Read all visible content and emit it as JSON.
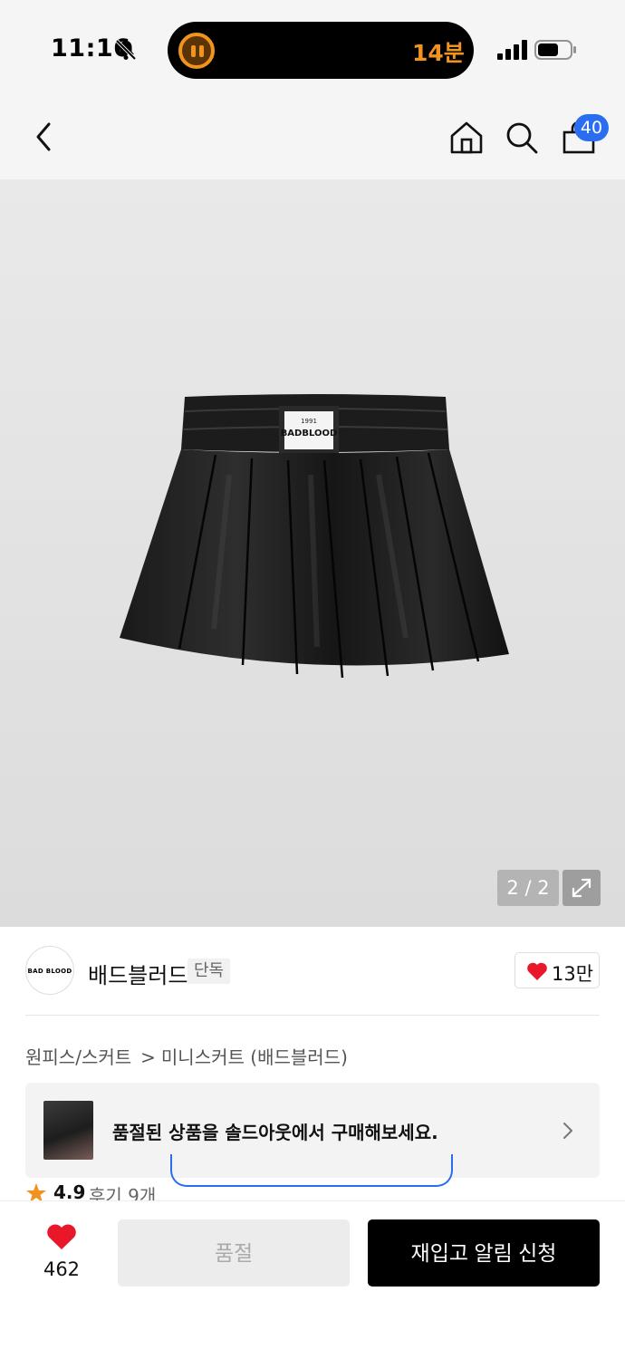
{
  "status_bar": {
    "time": "11:16",
    "timer": "14분",
    "bell_icon": "bell-slash-icon",
    "signal_icon": "cellular-signal-icon",
    "battery_icon": "battery-icon"
  },
  "header": {
    "back_icon": "chevron-left-icon",
    "home_icon": "home-icon",
    "search_icon": "search-icon",
    "cart_icon": "shopping-bag-icon",
    "cart_count": "40",
    "badge_color": "#2b6df0"
  },
  "gallery": {
    "counter": "2 / 2",
    "expand_icon": "expand-icon",
    "label_text": "BADBLOOD",
    "label_year": "1991"
  },
  "brand": {
    "logo_text": "BAD BLOOD",
    "name": "배드블러드",
    "tag": "단독",
    "likes": "13만"
  },
  "breadcrumb": {
    "items": [
      "원피스/스커트",
      "미니스커트 (배드블러드)"
    ],
    "separator": ">"
  },
  "soldout_card": {
    "text": "품절된 상품을 솔드아웃에서 구매해보세요.",
    "chevron_icon": "chevron-right-icon"
  },
  "rating": {
    "score": "4.9",
    "review_label": "후기 9개",
    "star_color": "#f0931f"
  },
  "bottom_bar": {
    "like_count": "462",
    "soldout_label": "품절",
    "restock_label": "재입고 알림 신청",
    "heart_color": "#e8182a"
  }
}
